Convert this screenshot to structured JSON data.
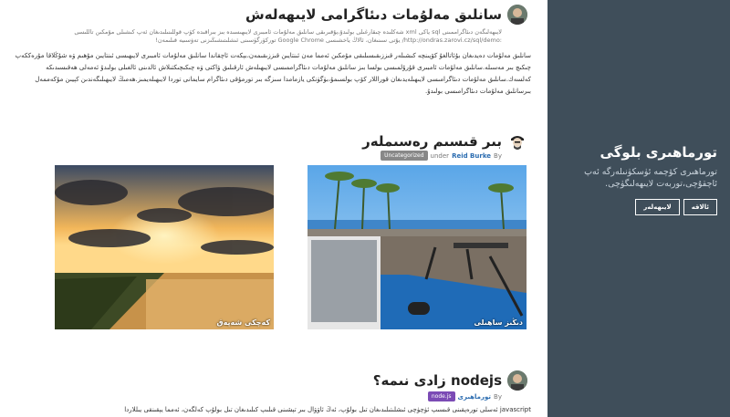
{
  "sidebar": {
    "title": "تورماھىرى بلوگى",
    "description": "تورماھىرى كۆچمە ئۈسكۈنىلەرگە ئەپ ئاچقۇچى،توربەت لايىھەلىگۈچى.",
    "buttons": [
      "ئالاقە",
      "لايىھەلەر"
    ]
  },
  "posts": [
    {
      "title": "سانلىق مەلۇمات دىئاگرامى لايىھەلەش",
      "small_text": "لايىھەلىگەن دىئاگراممىنى sql ياكى xml شەكلىدە چىقارغىلى بولىدۇ،يۇقىرىقى سانلىق مەلۇمات ئامبىرى لايىھىسىدە بىز بىراقىدە كۆپ قوللىنىلىدىغان ئەپ كىشىلى مۇمكىن تاللىسى :http://ondras.zarovi.cz/sql/demo/ يۇتى سىنىغان، ئالاڭ ياخشىسى Google Chrome توركۆرگۈسىنى ئىشلىتىشىڭىزنى تەۋسىيە قىلىمەن!",
      "paragraph": "سانلىق مەلۇمات دەيدىغان بۇئاتالغۇ كۆپىنچە كىشىلەر قىززىقىسىلىقى مۇمكىن ئەمما مەن ئىنتايىن قىززىقىمەن،بېكەت ئاچقاندا سانلىق مەلۇمات ئامبىرى لايىھىسى ئىنتايىن مۇھىم ۋە شۇڭلاقا مۇرەككەپ چىكىچ بىر مەسىلە.سانلىق مەلۇمات ئامبىرى قۇرۇلمىسى بولسا بىز سانلىق مەلۇمات دىئاگراممىسى لايىھىلەش ئارقىلىق ۋاكتى ۋە چىكىچىكتىلاش ئالدىنى ئالغىلى بولىدۇ ئەمەلى ھەقىسىدىكە كەلسەك.سانلىق مەلۇمات دىئاگرامىسى لايىھىلەيدىغان قوراللار كۆپ بولسىمۇ،بۈگۈنكى يازمامدا سىزگە بىر تورمۇقى دىئاگرام سايمانى توردا لايىھىلەيمىز.ھەمىڭ لايىھىلىگەندىن كېيىن مۇكەممەل بىرسانلىق مەلۇمات دىئاگرامىسى بولىدۇ."
    },
    {
      "title": "بىر قىسىم رەسىملەر",
      "by": "By",
      "author": "Reid Burke",
      "under": "under",
      "tag": "Uncategorized",
      "captions": [
        "دىڭىز ساھىلى",
        "كەچكى شەپەق"
      ]
    },
    {
      "title": "nodejs زادى نىمە؟",
      "by": "By",
      "author": "تورماھىرى",
      "tag": "node.js",
      "paragraph": "javascript ئەسلى تورەپقىنى قىسىپ ئۈچۈچى ئىشلىتىلىدىغان تىل بولۇپ، ئەڭ ئاۋۋال بىر تېشىنى قىلىپ كىلىدىغان تىل بولۇپ كەلگەن، ئەمما يېقىنقى يىللاردا"
    }
  ],
  "colors": {
    "sidebar_bg": "#3f4e5a",
    "link": "#2b6cb0",
    "tag_gray": "#888888",
    "tag_purple": "#7b4bb5"
  }
}
